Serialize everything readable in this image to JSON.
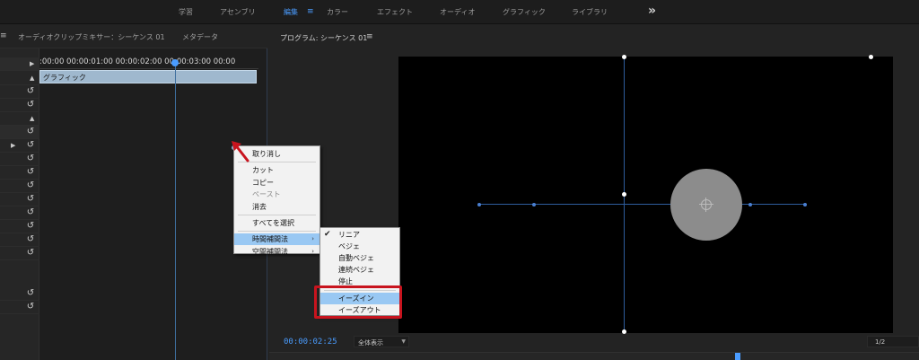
{
  "workspace_tabs": [
    {
      "label": "学習",
      "active": false
    },
    {
      "label": "アセンブリ",
      "active": false
    },
    {
      "label": "編集",
      "active": true
    },
    {
      "label": "カラー",
      "active": false
    },
    {
      "label": "エフェクト",
      "active": false
    },
    {
      "label": "オーディオ",
      "active": false
    },
    {
      "label": "グラフィック",
      "active": false
    },
    {
      "label": "ライブラリ",
      "active": false
    }
  ],
  "workspace_more": "»",
  "left_panel": {
    "menu_glyph": "≡",
    "tabs": [
      "オーディオクリップミキサー：シーケンス 01",
      "メタデータ"
    ],
    "timecodes": ":00:00 00:00:01:00 00:00:02:00 00:00:03:00 00:00",
    "clip_label": "グラフィック"
  },
  "program": {
    "title": "プログラム: シーケンス 01",
    "menu_glyph": "≡",
    "timecode": "00:00:02:25",
    "zoom": "全体表示",
    "resolution": "1/2"
  },
  "context_menu": {
    "items": [
      {
        "label": "取り消し",
        "disabled": false
      },
      {
        "sep": true
      },
      {
        "label": "カット",
        "disabled": false
      },
      {
        "label": "コピー",
        "disabled": false
      },
      {
        "label": "ペースト",
        "disabled": true
      },
      {
        "label": "消去",
        "disabled": false
      },
      {
        "sep": true
      },
      {
        "label": "すべてを選択",
        "disabled": false
      },
      {
        "sep": true
      },
      {
        "label": "時間補間法",
        "disabled": false,
        "submenu": true,
        "highlight": true
      },
      {
        "label": "空間補間法",
        "disabled": false,
        "submenu": true
      }
    ]
  },
  "submenu": {
    "items": [
      {
        "label": "リニア",
        "checked": true
      },
      {
        "label": "ベジェ"
      },
      {
        "label": "自動ベジェ"
      },
      {
        "label": "連続ベジェ"
      },
      {
        "label": "停止"
      },
      {
        "sep": true
      },
      {
        "label": "イーズイン",
        "highlight": true
      },
      {
        "label": "イーズアウト"
      }
    ]
  },
  "icons": {
    "check": "✔",
    "submenu_arrow": "›",
    "reset": "↺",
    "triangle": "▶",
    "collapse": "▲"
  },
  "colors": {
    "accent": "#4a9cff",
    "highlight_box": "#c8141e",
    "menu_highlight": "#99c8f3"
  }
}
